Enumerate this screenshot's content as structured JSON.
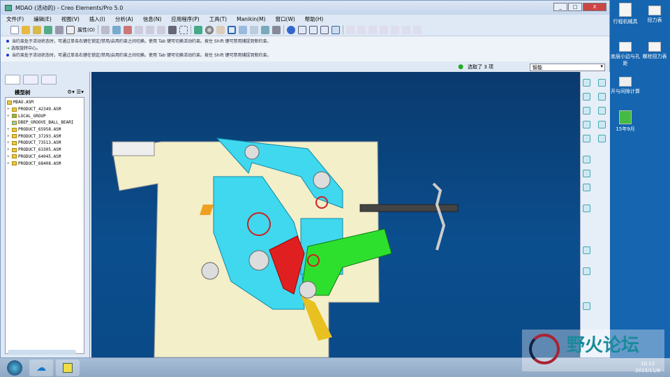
{
  "window": {
    "title": "MDAO (活动的) - Creo Elements/Pro 5.0",
    "controls": [
      "_",
      "□",
      "X"
    ]
  },
  "menu": [
    "文件(F)",
    "编辑(E)",
    "视图(V)",
    "插入(I)",
    "分析(A)",
    "信息(N)",
    "应用程序(P)",
    "工具(T)",
    "Manikin(M)",
    "窗口(W)",
    "帮助(H)"
  ],
  "toolbar": {
    "properties_label": "属性(O)"
  },
  "messages": [
    {
      "icon": "bullet",
      "text": "当约束处于活动状态时，可通过单击右键在锁定/禁用/启用约束之间切换。使用 Tab 键可切换活动约束。按住 Shift 键可禁用捕捉到新约束。"
    },
    {
      "icon": "arrow",
      "text": "选取旋转中心。"
    },
    {
      "icon": "bullet",
      "text": "当约束处于活动状态时，可通过单击右键在锁定/禁用/启用约束之间切换。使用 Tab 键可切换活动约束。按住 Shift 键可禁用捕捉到新约束。"
    }
  ],
  "status": {
    "selected": "选取了 3 项",
    "filter": "智能"
  },
  "model_tree": {
    "title": "模型树",
    "items": [
      {
        "label": "MDAO.ASM",
        "level": 0
      },
      {
        "label": "PRODUCT_42349.ASM",
        "level": 1
      },
      {
        "label": "LOCAL_GROUP",
        "level": 1
      },
      {
        "label": "DBEP_GROOVE_BALL_BEARI",
        "level": 1
      },
      {
        "label": "PRODUCT_65958.ASM",
        "level": 1
      },
      {
        "label": "PRODUCT_37293.ASM",
        "level": 1
      },
      {
        "label": "PRODUCT_73513.ASM",
        "level": 1
      },
      {
        "label": "PRODUCT_63305.ASM",
        "level": 1
      },
      {
        "label": "PRODUCT_64045.ASM",
        "level": 1
      },
      {
        "label": "PRODUCT_68408.ASM",
        "level": 1
      }
    ]
  },
  "desktop": [
    "行程机械具",
    "扭力表",
    "底层小边与孔距",
    "螺栓扭力表",
    "开与间隙计算",
    "15年9月"
  ],
  "clock": {
    "time": "10:13",
    "date": "2015/11/8"
  },
  "watermark": "野火论坛",
  "colors": {
    "viewport": "#0b4e8e",
    "plate": "#f3efc8",
    "cyan": "#3fd8ee",
    "green": "#2ee02e",
    "red": "#e02020",
    "yellow": "#e8c020"
  }
}
